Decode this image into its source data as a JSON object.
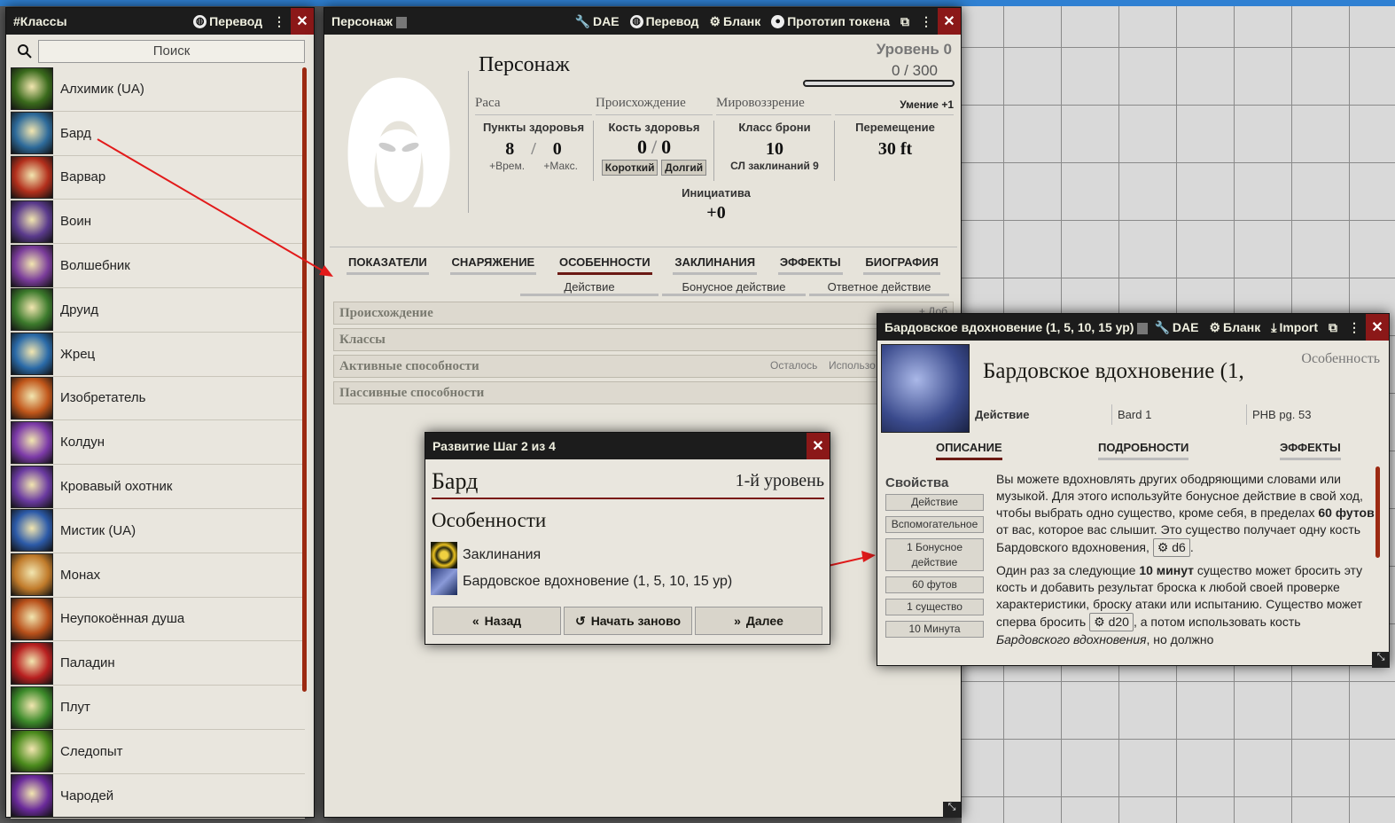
{
  "classes_window": {
    "title": "#Классы",
    "translate_label": "Перевод",
    "search_placeholder": "Поиск",
    "items": [
      {
        "label": "Алхимик (UA)",
        "color": "#3a6a1c"
      },
      {
        "label": "Бард",
        "color": "#2d6a9a"
      },
      {
        "label": "Варвар",
        "color": "#b22f1c"
      },
      {
        "label": "Воин",
        "color": "#5a3a8c"
      },
      {
        "label": "Волшебник",
        "color": "#7a3c9a"
      },
      {
        "label": "Друид",
        "color": "#3c7a2c"
      },
      {
        "label": "Жрец",
        "color": "#2a6aa8"
      },
      {
        "label": "Изобретатель",
        "color": "#c0561a"
      },
      {
        "label": "Колдун",
        "color": "#7c3aa8"
      },
      {
        "label": "Кровавый охотник",
        "color": "#6a3aa0"
      },
      {
        "label": "Мистик (UA)",
        "color": "#2c5aa8"
      },
      {
        "label": "Монах",
        "color": "#c07a2a"
      },
      {
        "label": "Неупокоённая душа",
        "color": "#b8501a"
      },
      {
        "label": "Паладин",
        "color": "#b82020"
      },
      {
        "label": "Плут",
        "color": "#3c8a2a"
      },
      {
        "label": "Следопыт",
        "color": "#4a8a1c"
      },
      {
        "label": "Чародей",
        "color": "#6a2a9a"
      }
    ]
  },
  "character_window": {
    "title": "Персонаж",
    "buttons": {
      "dae": "DAE",
      "translate": "Перевод",
      "sheet": "Бланк",
      "token": "Прототип токена"
    },
    "name": "Персонаж",
    "level": "Уровень 0",
    "xp_current": "0",
    "xp_sep": "/",
    "xp_max": "300",
    "traits": {
      "race": "Раса",
      "background": "Происхождение",
      "alignment": "Мировоззрение",
      "proficiency": "Умение +1"
    },
    "hp": {
      "label": "Пункты здоровья",
      "value": "8",
      "sep": "/",
      "max": "0",
      "temp": "+Врем.",
      "tmax": "+Макс."
    },
    "hit_dice": {
      "label": "Кость здоровья",
      "value": "0",
      "sep": "/",
      "max": "0",
      "short": "Короткий",
      "long": "Долгий"
    },
    "ac": {
      "label": "Класс брони",
      "value": "10",
      "dc": "СЛ заклинаний 9"
    },
    "speed": {
      "label": "Перемещение",
      "value": "30 ft"
    },
    "initiative": {
      "label": "Инициатива",
      "value": "+0"
    },
    "tabs": [
      "ПОКАЗАТЕЛИ",
      "СНАРЯЖЕНИЕ",
      "ОСОБЕННОСТИ",
      "ЗАКЛИНАНИЯ",
      "ЭФФЕКТЫ",
      "БИОГРАФИЯ"
    ],
    "subtabs": {
      "action": "Действие",
      "bonus": "Бонусное действие",
      "reaction": "Ответное действие"
    },
    "sections": {
      "origin": "Происхождение",
      "add": "+ Доб",
      "classes": "Классы",
      "active": "Активные способности",
      "remaining": "Осталось",
      "usage": "Использо",
      "passive": "Пассивные способности"
    }
  },
  "advancement_dialog": {
    "title": "Развитие Шаг 2 из 4",
    "class_name": "Бард",
    "level": "1-й уровень",
    "section": "Особенности",
    "features": [
      "Заклинания",
      "Бардовское вдохновение (1, 5, 10, 15 ур)"
    ],
    "back": "Назад",
    "restart": "Начать заново",
    "next": "Далее"
  },
  "feature_window": {
    "title": "Бардовское вдохновение (1, 5, 10, 15 ур)",
    "buttons": {
      "dae": "DAE",
      "sheet": "Бланк",
      "import": "Import"
    },
    "name": "Бардовское вдохновение (1,",
    "type": "Особенность",
    "activation": "Действие",
    "source_class": "Bard 1",
    "source": "PHB pg. 53",
    "tabs": [
      "ОПИСАНИЕ",
      "ПОДРОБНОСТИ",
      "ЭФФЕКТЫ"
    ],
    "properties_label": "Свойства",
    "properties": [
      "Действие",
      "Вспомогательное",
      "1 Бонусное действие",
      "60 футов",
      "1 существо",
      "10 Минута"
    ],
    "desc1_a": "Вы можете вдохновлять других ободряющими словами или музыкой. Для этого используйте бонусное действие в свой ход, чтобы выбрать одно существо, кроме себя, в пределах ",
    "desc1_b": "60 футов",
    "desc1_c": " от вас, которое вас слышит. Это существо получает одну кость Бардовского вдохновения, ",
    "desc1_d": "d6",
    "desc1_e": ".",
    "desc2_a": "Один раз за следующие ",
    "desc2_b": "10 минут",
    "desc2_c": " существо может бросить эту кость и добавить результат броска к любой своей проверке характеристики, броску атаки или испытанию. Существо может сперва бросить ",
    "desc2_d": "d20",
    "desc2_e": ", а потом использовать кость ",
    "desc2_f": "Бардовского вдохновения",
    "desc2_g": ", но должно"
  }
}
